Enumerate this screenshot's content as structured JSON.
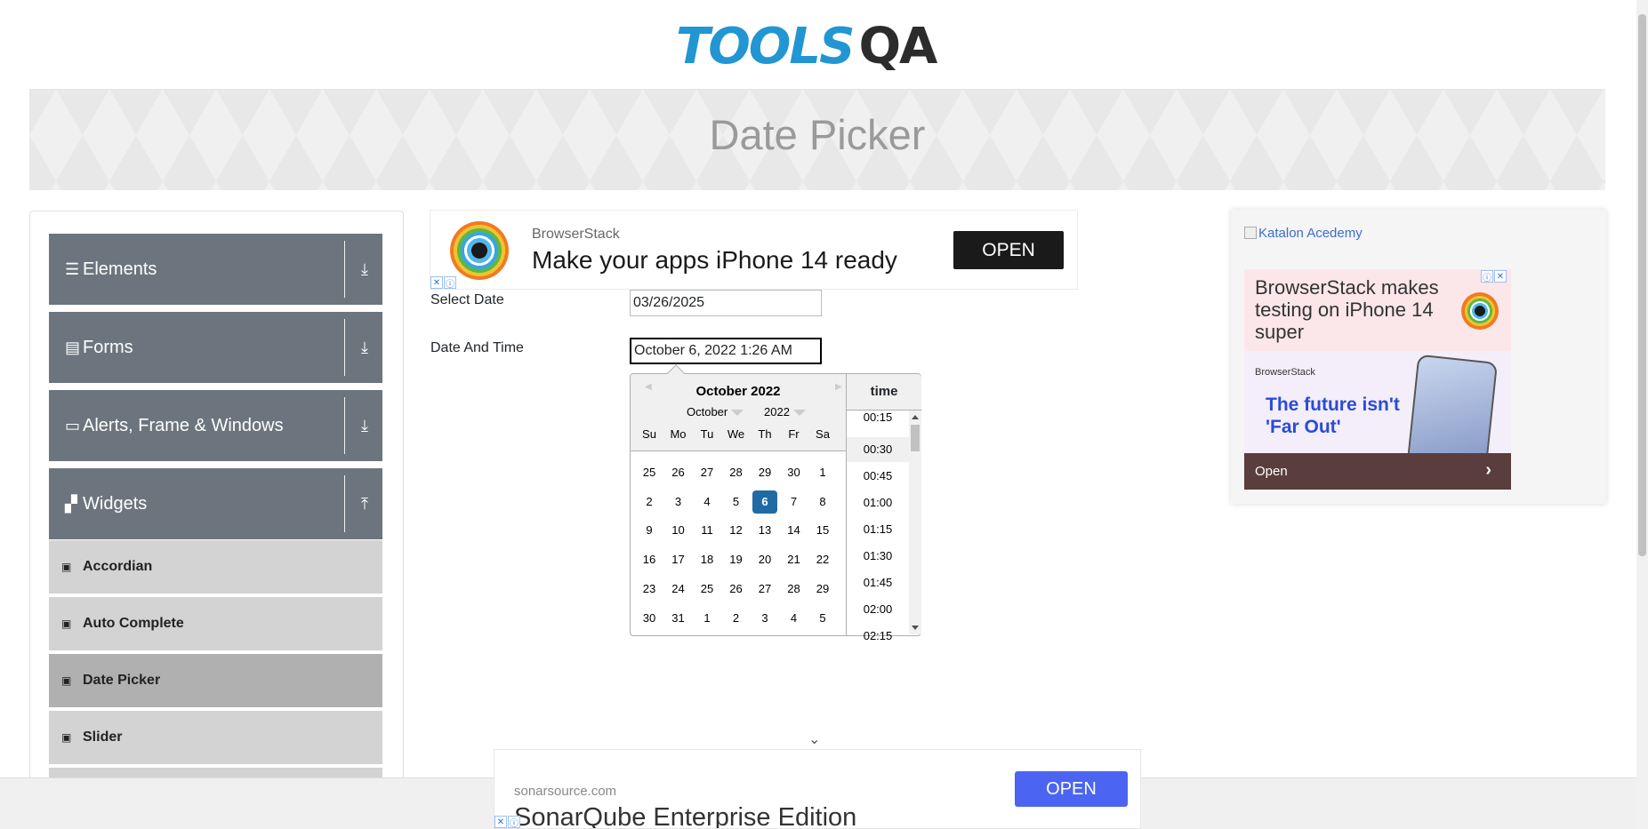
{
  "logo": {
    "part1": "TOOLS",
    "part2": "QA"
  },
  "banner": {
    "title": "Date Picker"
  },
  "sidebar": {
    "groups": [
      {
        "label": "Elements",
        "icon": "list-icon"
      },
      {
        "label": "Forms",
        "icon": "document-icon"
      },
      {
        "label": "Alerts, Frame & Windows",
        "icon": "window-icon"
      },
      {
        "label": "Widgets",
        "icon": "widgets-icon"
      }
    ],
    "items": [
      {
        "label": "Accordian"
      },
      {
        "label": "Auto Complete"
      },
      {
        "label": "Date Picker",
        "active": true
      },
      {
        "label": "Slider"
      }
    ]
  },
  "ad_top": {
    "brand": "BrowserStack",
    "headline": "Make your apps iPhone 14 ready",
    "button": "OPEN"
  },
  "form": {
    "select_date_label": "Select Date",
    "select_date_value": "03/26/2025",
    "date_time_label": "Date And Time",
    "date_time_value": "October 6, 2022 1:26 AM"
  },
  "calendar": {
    "title": "October 2022",
    "month_select": "October",
    "year_select": "2022",
    "day_names": [
      "Su",
      "Mo",
      "Tu",
      "We",
      "Th",
      "Fr",
      "Sa"
    ],
    "weeks": [
      [
        "25",
        "26",
        "27",
        "28",
        "29",
        "30",
        "1"
      ],
      [
        "2",
        "3",
        "4",
        "5",
        "6",
        "7",
        "8"
      ],
      [
        "9",
        "10",
        "11",
        "12",
        "13",
        "14",
        "15"
      ],
      [
        "16",
        "17",
        "18",
        "19",
        "20",
        "21",
        "22"
      ],
      [
        "23",
        "24",
        "25",
        "26",
        "27",
        "28",
        "29"
      ],
      [
        "30",
        "31",
        "1",
        "2",
        "3",
        "4",
        "5"
      ]
    ],
    "selected_day": "6",
    "time_header": "time",
    "times": [
      "00:15",
      "00:30",
      "00:45",
      "01:00",
      "01:15",
      "01:30",
      "01:45",
      "02:00",
      "02:15"
    ],
    "highlighted_time": "00:30",
    "selected_color": "#216ba5"
  },
  "ad_right": {
    "image_alt": "Katalon Acedemy",
    "headline": "BrowserStack makes testing on iPhone 14 super",
    "brand": "BrowserStack",
    "tagline": "The future isn't 'Far Out'",
    "button": "Open"
  },
  "ad_bottom": {
    "domain": "sonarsource.com",
    "title": "SonarQube Enterprise Edition",
    "button": "OPEN"
  }
}
